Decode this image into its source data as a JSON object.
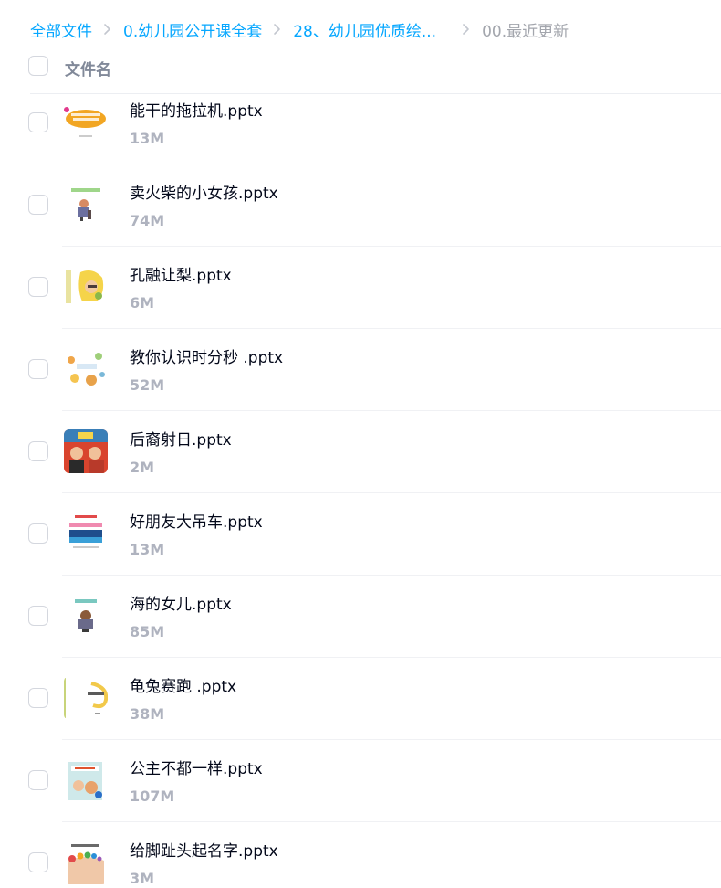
{
  "breadcrumb": {
    "items": [
      {
        "label": "全部文件"
      },
      {
        "label": "0.幼儿园公开课全套"
      },
      {
        "label": "28、幼儿园优质绘..."
      },
      {
        "label": "00.最近更新"
      }
    ]
  },
  "list_header": {
    "column_name": "文件名"
  },
  "files": [
    {
      "name": "能干的拖拉机.pptx",
      "size": "13M",
      "thumb_icon": "tractor-cover-thumbnail"
    },
    {
      "name": "卖火柴的小女孩.pptx",
      "size": "74M",
      "thumb_icon": "match-girl-cover-thumbnail"
    },
    {
      "name": "孔融让梨.pptx",
      "size": "6M",
      "thumb_icon": "kongrong-pear-cover-thumbnail"
    },
    {
      "name": "教你认识时分秒 .pptx",
      "size": "52M",
      "thumb_icon": "clock-lesson-cover-thumbnail"
    },
    {
      "name": "后裔射日.pptx",
      "size": "2M",
      "thumb_icon": "houyi-sun-cover-thumbnail"
    },
    {
      "name": "好朋友大吊车.pptx",
      "size": "13M",
      "thumb_icon": "crane-cover-thumbnail"
    },
    {
      "name": "海的女儿.pptx",
      "size": "85M",
      "thumb_icon": "mermaid-cover-thumbnail"
    },
    {
      "name": "龟兔赛跑 .pptx",
      "size": "38M",
      "thumb_icon": "tortoise-hare-cover-thumbnail"
    },
    {
      "name": "公主不都一样.pptx",
      "size": "107M",
      "thumb_icon": "princess-cover-thumbnail"
    },
    {
      "name": "给脚趾头起名字.pptx",
      "size": "3M",
      "thumb_icon": "toes-cover-thumbnail"
    }
  ],
  "colors": {
    "link": "#06a7ff",
    "muted": "#a3a6ad",
    "text": "#03081a",
    "size_text": "#afb3bf"
  }
}
